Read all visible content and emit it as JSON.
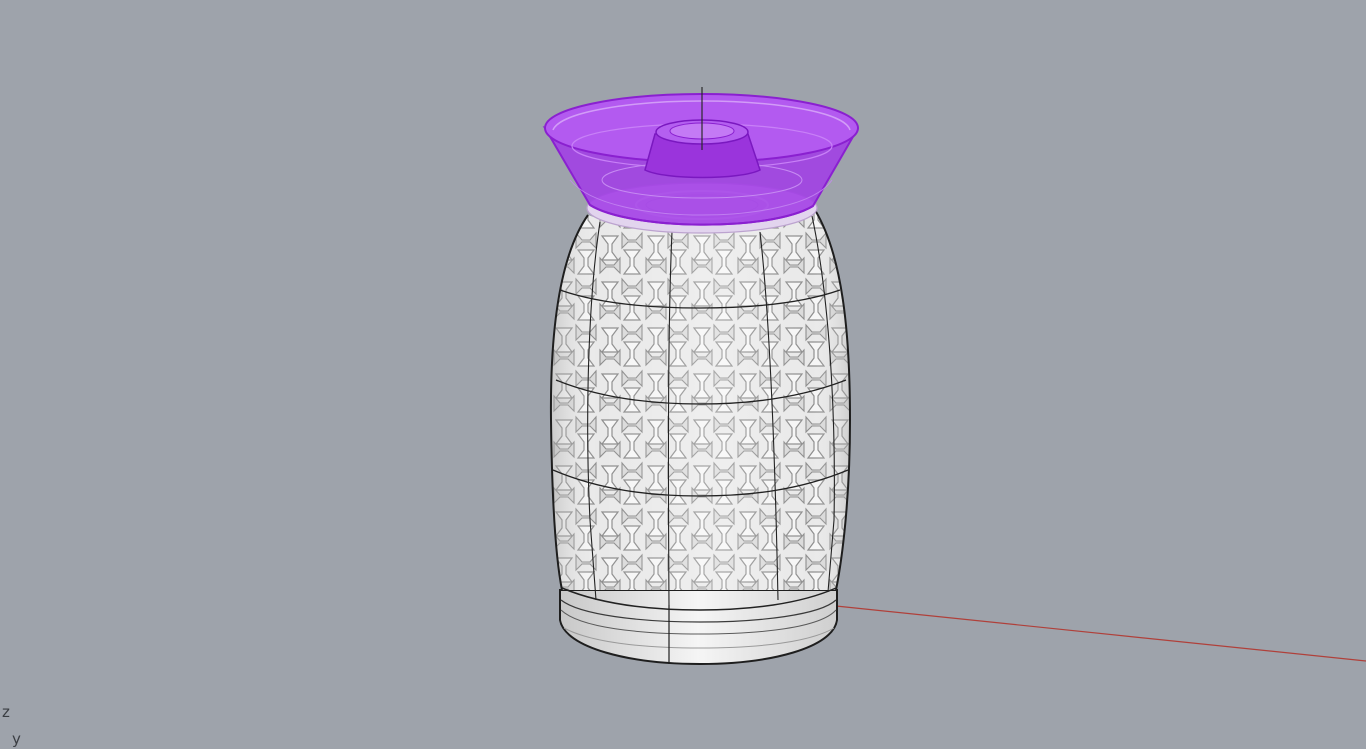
{
  "viewport": {
    "background": "#9ea3ab",
    "axis_labels": {
      "z": "z",
      "y": "y"
    },
    "world_axes": {
      "x_axis_color": "#b0403a",
      "z_axis_color": "#2a2a2a"
    }
  },
  "model": {
    "vase_body": {
      "fill": "#ececec",
      "pattern_color": "#9a9a9a",
      "edge_color": "#1e1e1e",
      "pattern": "woven-interlocking-tiles"
    },
    "funnel_lid": {
      "color": "#a339e6",
      "edge_color": "#c77cff",
      "selected": true
    }
  }
}
